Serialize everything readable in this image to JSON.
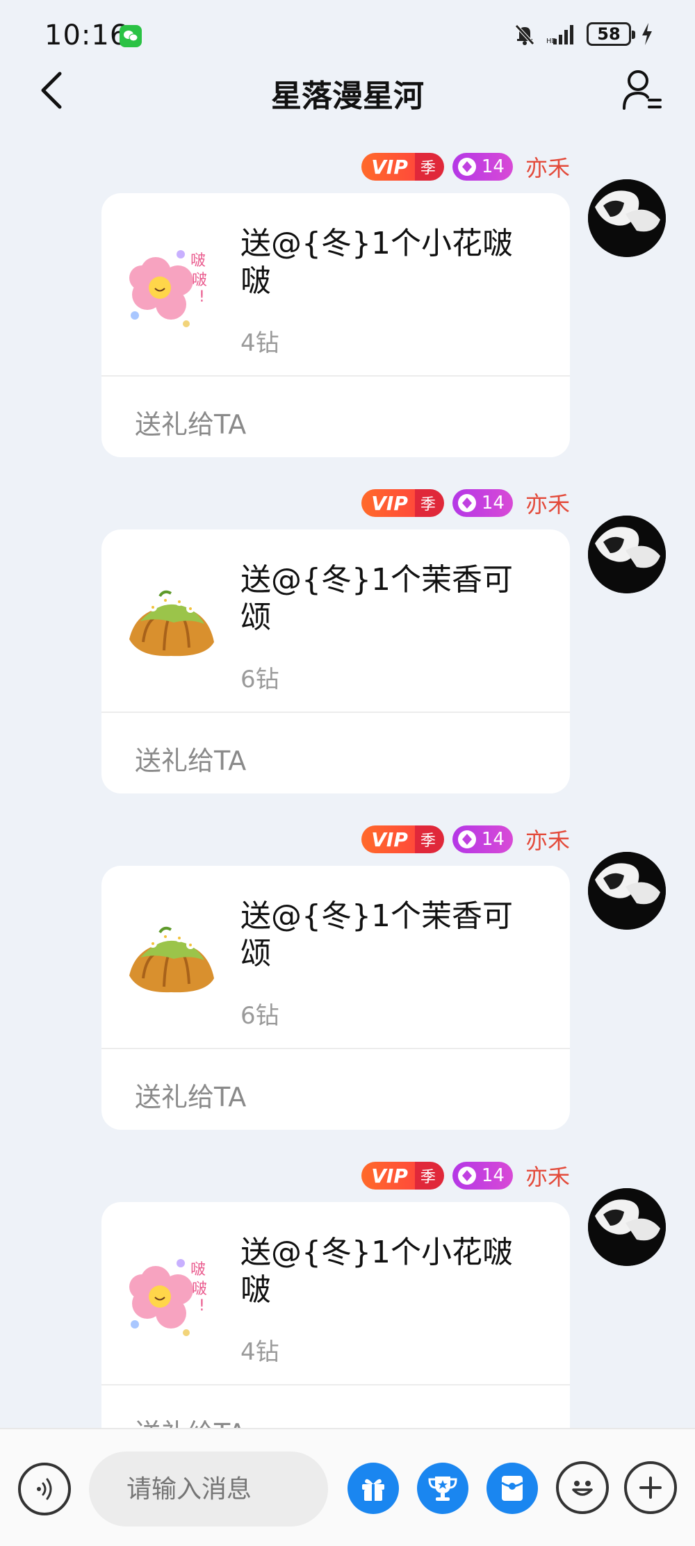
{
  "status": {
    "time": "10:16",
    "battery": "58"
  },
  "header": {
    "title": "星落漫星河"
  },
  "messages": [
    {
      "vip": "VIP",
      "season": "季",
      "level": "14",
      "sender": "亦禾",
      "gift_text": "送@{冬}1个小花啵啵",
      "price": "4钻",
      "action": "送礼给TA",
      "gift_icon": "flower-gift-icon"
    },
    {
      "vip": "VIP",
      "season": "季",
      "level": "14",
      "sender": "亦禾",
      "gift_text": "送@{冬}1个茉香可颂",
      "price": "6钻",
      "action": "送礼给TA",
      "gift_icon": "croissant-gift-icon"
    },
    {
      "vip": "VIP",
      "season": "季",
      "level": "14",
      "sender": "亦禾",
      "gift_text": "送@{冬}1个茉香可颂",
      "price": "6钻",
      "action": "送礼给TA",
      "gift_icon": "croissant-gift-icon"
    },
    {
      "vip": "VIP",
      "season": "季",
      "level": "14",
      "sender": "亦禾",
      "gift_text": "送@{冬}1个小花啵啵",
      "price": "4钻",
      "action": "送礼给TA",
      "gift_icon": "flower-gift-icon"
    }
  ],
  "input": {
    "placeholder": "请输入消息"
  },
  "colors": {
    "accent_blue": "#1a86f0",
    "sender_red": "#e34a3a",
    "vip_orange": "#ff5a2a",
    "level_purple": "#c040e0"
  },
  "icons": {
    "back": "back-icon",
    "profile": "profile-menu-icon",
    "voice": "voice-icon",
    "gift": "gift-icon",
    "trophy": "trophy-icon",
    "red_packet": "red-packet-icon",
    "emoji": "emoji-icon",
    "plus": "plus-icon"
  }
}
